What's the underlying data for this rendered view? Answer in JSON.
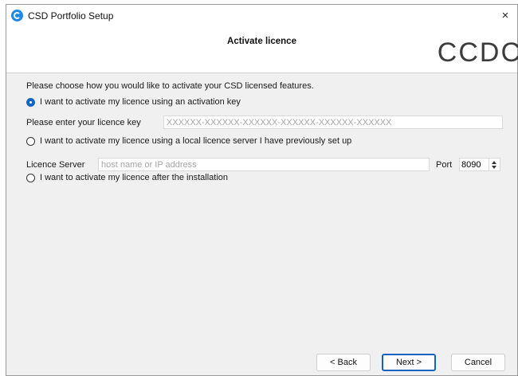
{
  "window": {
    "title": "CSD Portfolio Setup",
    "close_glyph": "×"
  },
  "header": {
    "title": "Activate licence",
    "brand": "CCDC"
  },
  "main": {
    "intro": "Please choose how you would like to activate your CSD licensed features.",
    "options": [
      {
        "label": "I want to activate my licence using an activation key",
        "selected": true
      },
      {
        "label": "I want to activate my licence using a local licence server I have previously set up",
        "selected": false
      },
      {
        "label": "I want to activate my licence after the installation",
        "selected": false
      }
    ],
    "licence_key": {
      "label": "Please enter your licence key",
      "placeholder": "XXXXXX-XXXXXX-XXXXXX-XXXXXX-XXXXXX-XXXXXX",
      "value": ""
    },
    "licence_server": {
      "label": "Licence Server",
      "placeholder": "host name or IP address",
      "value": ""
    },
    "port": {
      "label": "Port",
      "value": "8090"
    }
  },
  "buttons": {
    "back": "< Back",
    "next": "Next >",
    "cancel": "Cancel"
  },
  "colors": {
    "accent": "#1565c0",
    "app_icon": "#1e88e5"
  },
  "icons": {
    "app": "ccdc-app-icon",
    "close": "close-icon"
  }
}
